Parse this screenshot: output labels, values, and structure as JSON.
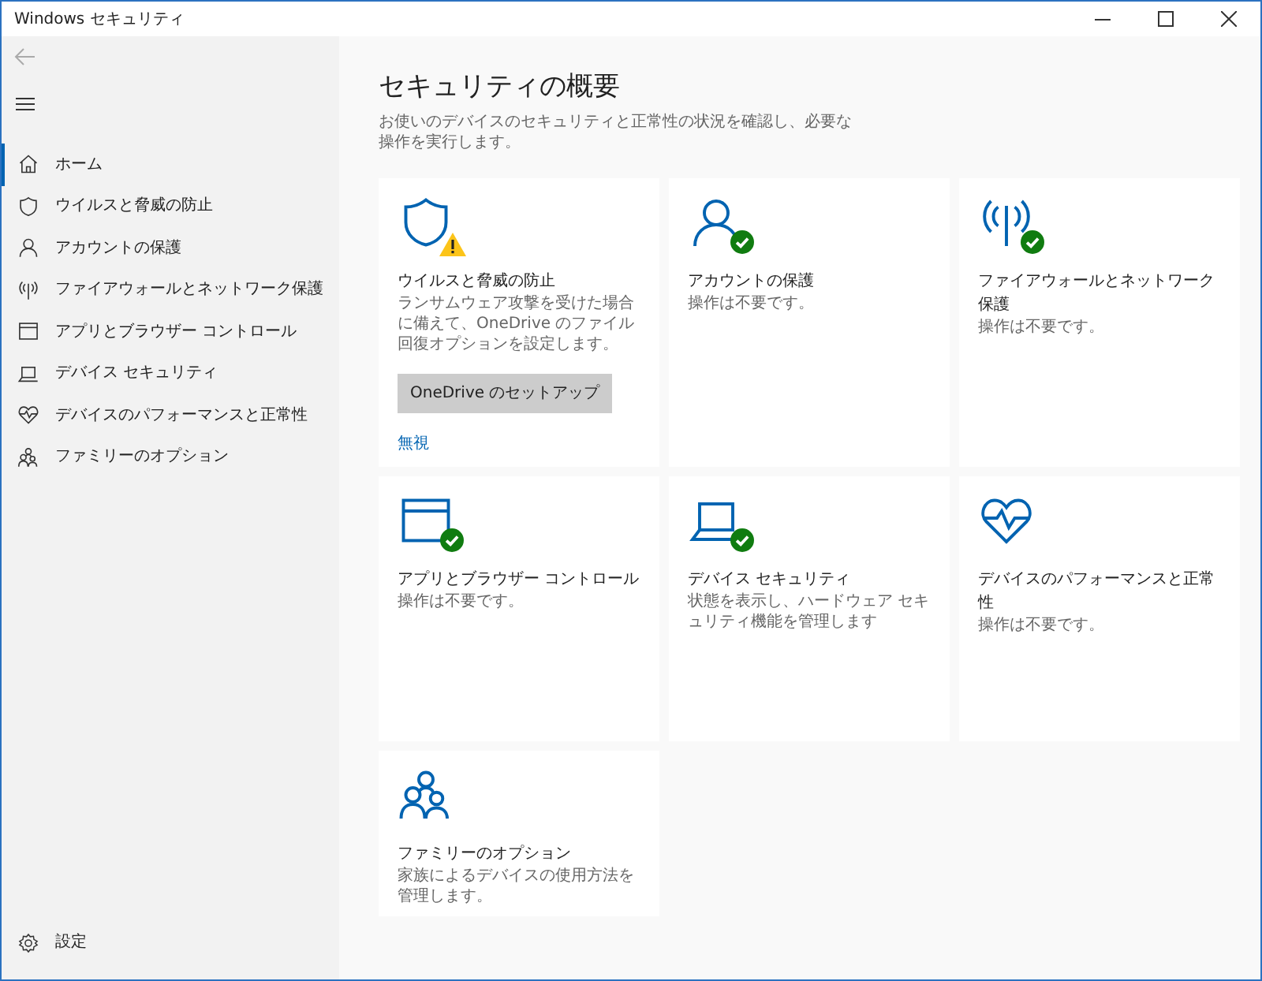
{
  "window": {
    "title": "Windows セキュリティ"
  },
  "sidebar": {
    "back_button": {
      "disabled": true
    },
    "items": [
      {
        "label": "ホーム",
        "selected": true
      },
      {
        "label": "ウイルスと脅威の防止",
        "selected": false
      },
      {
        "label": "アカウントの保護",
        "selected": false
      },
      {
        "label": "ファイアウォールとネットワーク保護",
        "selected": false
      },
      {
        "label": "アプリとブラウザー コントロール",
        "selected": false
      },
      {
        "label": "デバイス セキュリティ",
        "selected": false
      },
      {
        "label": "デバイスのパフォーマンスと正常性",
        "selected": false
      },
      {
        "label": "ファミリーのオプション",
        "selected": false
      }
    ],
    "settings": {
      "label": "設定"
    }
  },
  "page": {
    "title": "セキュリティの概要",
    "description": "お使いのデバイスのセキュリティと正常性の状況を確認し、必要な操作を実行します。"
  },
  "tiles": [
    {
      "title": "ウイルスと脅威の防止",
      "description": "ランサムウェア攻撃を受けた場合に備えて、OneDrive のファイル回復オプションを設定します。",
      "warning": true,
      "check": false,
      "button": "OneDrive のセットアップ",
      "link": "無視"
    },
    {
      "title": "アカウントの保護",
      "description": "操作は不要です。",
      "warning": false,
      "check": true
    },
    {
      "title": "ファイアウォールとネットワーク保護",
      "description": "操作は不要です。",
      "warning": false,
      "check": true
    },
    {
      "title": "アプリとブラウザー コントロール",
      "description": "操作は不要です。",
      "warning": false,
      "check": true
    },
    {
      "title": "デバイス セキュリティ",
      "description": "状態を表示し、ハードウェア セキュリティ機能を管理します",
      "warning": false,
      "check": true
    },
    {
      "title": "デバイスのパフォーマンスと正常性",
      "description": "操作は不要です。",
      "warning": false,
      "check": false
    },
    {
      "title": "ファミリーのオプション",
      "description": "家族によるデバイスの使用方法を管理します。",
      "warning": false,
      "check": false
    }
  ]
}
